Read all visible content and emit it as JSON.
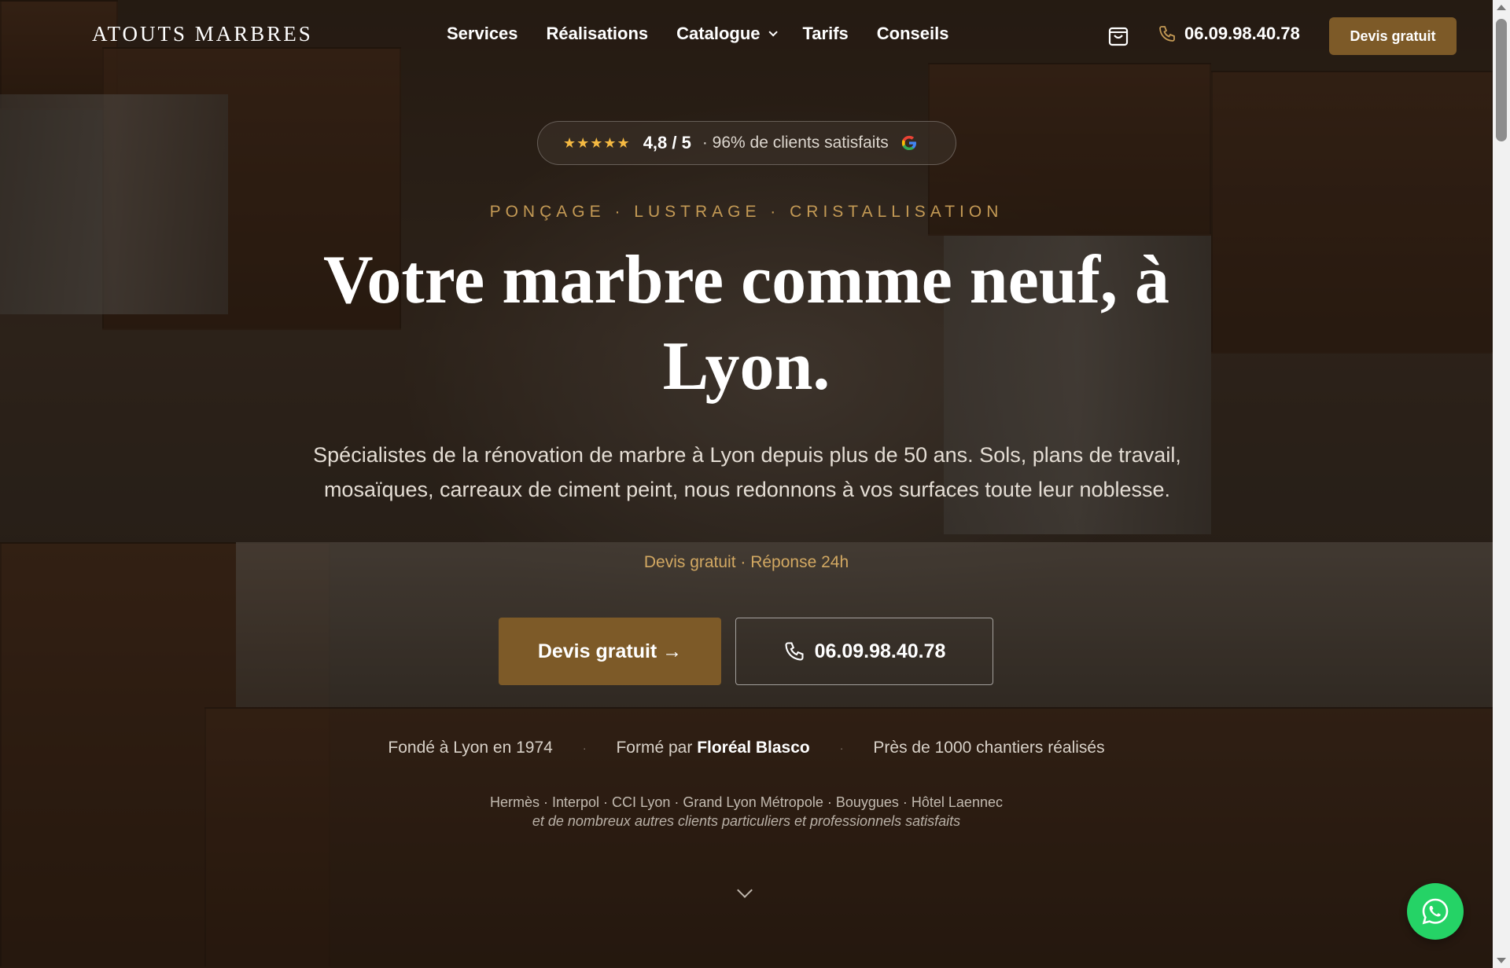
{
  "header": {
    "logo": "ATOUTS MARBRES",
    "nav": [
      "Services",
      "Réalisations",
      "Catalogue",
      "Tarifs",
      "Conseils"
    ],
    "phone": "06.09.98.40.78",
    "cta": "Devis gratuit"
  },
  "rating": {
    "stars": "★★★★★",
    "score": "4,8 / 5",
    "text": "· 96% de clients satisfaits"
  },
  "hero": {
    "tagline": "PONÇAGE · LUSTRAGE · CRISTALLISATION",
    "headline": "Votre marbre comme neuf, à Lyon.",
    "subtext": "Spécialistes de la rénovation de marbre à Lyon depuis plus de 50 ans. Sols, plans de travail, mosaïques, carreaux de ciment peint, nous redonnons à vos surfaces toute leur noblesse.",
    "quick": "Devis gratuit · Réponse 24h",
    "cta_primary": "Devis gratuit →",
    "cta_phone": "06.09.98.40.78"
  },
  "facts": {
    "founded": "Fondé à Lyon en 1974",
    "trained_prefix": "Formé par ",
    "trained_name": "Floréal Blasco",
    "projects": "Près de 1000 chantiers réalisés"
  },
  "clients": {
    "list": "Hermès · Interpol · CCI Lyon · Grand Lyon Métropole · Bouygues · Hôtel Laennec",
    "note": "et de nombreux autres clients particuliers et professionnels satisfaits"
  },
  "colors": {
    "accent": "#7d5a28",
    "gold_text": "#c49a55",
    "whatsapp": "#25d366",
    "star": "#f4b942"
  }
}
